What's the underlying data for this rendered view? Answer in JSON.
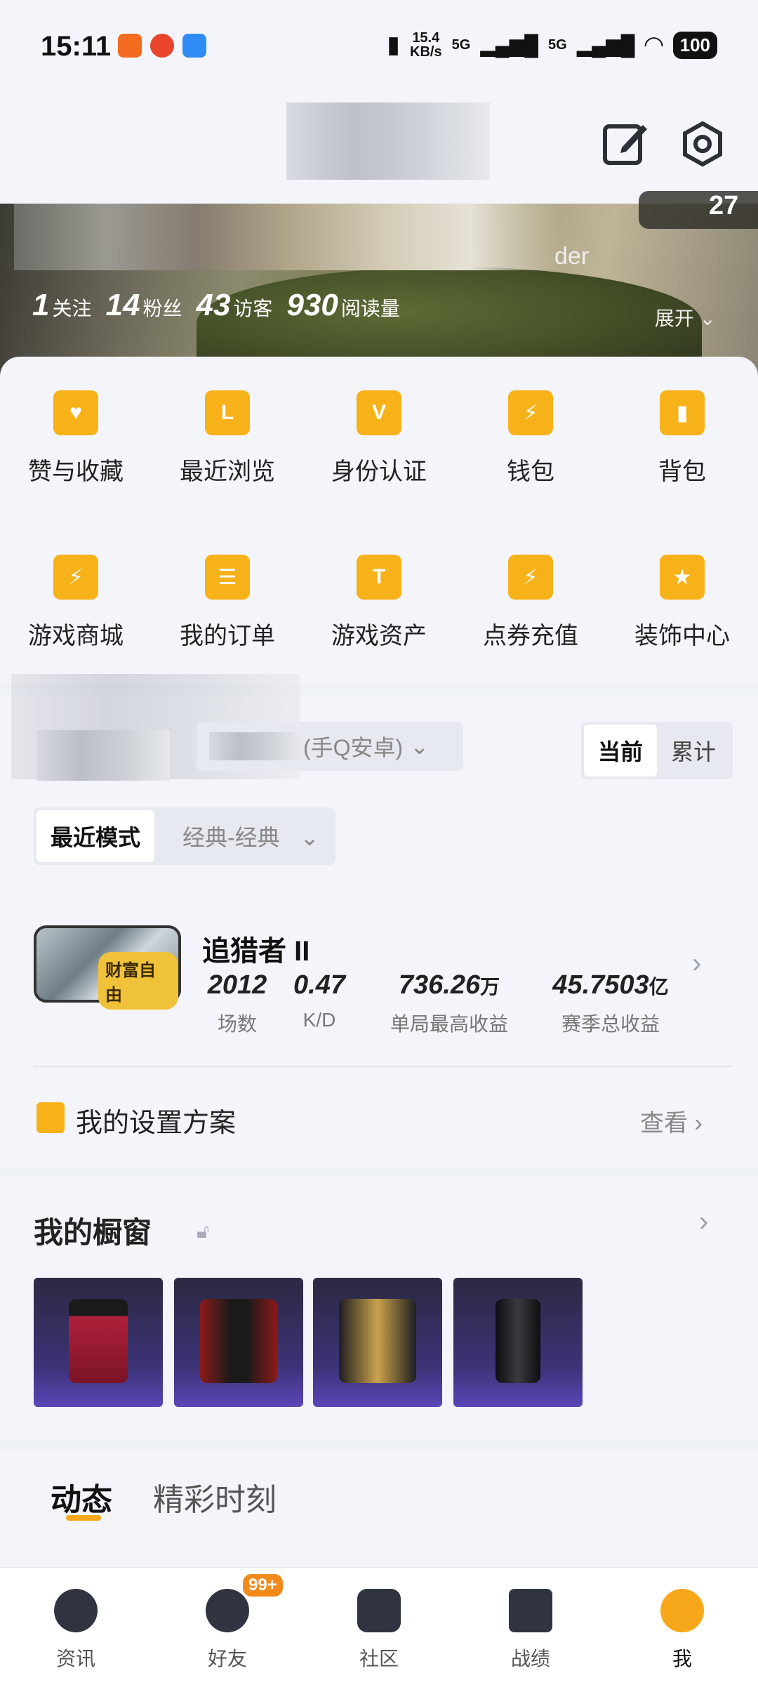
{
  "status_bar": {
    "time": "15:11",
    "network_speed": "15.4",
    "network_unit": "KB/s",
    "signal1": "5G",
    "signal2": "5G",
    "battery": "100"
  },
  "banner": {
    "badge_number": "27",
    "partial_text": "der",
    "stats": [
      {
        "value": "1",
        "label": "关注"
      },
      {
        "value": "14",
        "label": "粉丝"
      },
      {
        "value": "43",
        "label": "访客"
      },
      {
        "value": "930",
        "label": "阅读量"
      }
    ],
    "expand": "展开"
  },
  "shortcuts": [
    {
      "label": "赞与收藏",
      "icon": "heart-card-icon"
    },
    {
      "label": "最近浏览",
      "icon": "history-icon"
    },
    {
      "label": "身份认证",
      "icon": "verify-v-icon"
    },
    {
      "label": "钱包",
      "icon": "wallet-icon"
    },
    {
      "label": "背包",
      "icon": "backpack-icon"
    },
    {
      "label": "游戏商城",
      "icon": "shop-bag-icon"
    },
    {
      "label": "我的订单",
      "icon": "order-clipboard-icon"
    },
    {
      "label": "游戏资产",
      "icon": "shirt-coins-icon"
    },
    {
      "label": "点券充值",
      "icon": "coupon-cards-icon"
    },
    {
      "label": "装饰中心",
      "icon": "star-decor-icon"
    }
  ],
  "record": {
    "server_select": "(手Q安卓)",
    "scope_tabs": {
      "current": "当前",
      "total": "累计"
    },
    "mode_label": "最近模式",
    "mode_value": "经典-经典",
    "season_badge_text": "财富自由",
    "rank": "追猎者 II",
    "metrics": [
      {
        "value": "2012",
        "unit": "",
        "label": "场数"
      },
      {
        "value": "0.47",
        "unit": "",
        "label": "K/D"
      },
      {
        "value": "736.26",
        "unit": "万",
        "label": "单局最高收益"
      },
      {
        "value": "45.7503",
        "unit": "亿",
        "label": "赛季总收益"
      }
    ],
    "settings_title": "我的设置方案",
    "settings_action": "查看"
  },
  "showcase": {
    "title": "我的橱窗",
    "items": [
      {
        "name": "red-pants"
      },
      {
        "name": "red-jacket"
      },
      {
        "name": "gold-leather-jacket"
      },
      {
        "name": "black-leather-pants"
      }
    ]
  },
  "feed_tabs": {
    "active": "动态",
    "inactive": "精彩时刻"
  },
  "bottom_nav": [
    {
      "label": "资讯"
    },
    {
      "label": "好友",
      "badge": "99+"
    },
    {
      "label": "社区"
    },
    {
      "label": "战绩"
    },
    {
      "label": "我"
    }
  ],
  "colors": {
    "accent": "#f7a81a",
    "icon_yellow": "#f7b21a",
    "background": "#eef1f6"
  }
}
